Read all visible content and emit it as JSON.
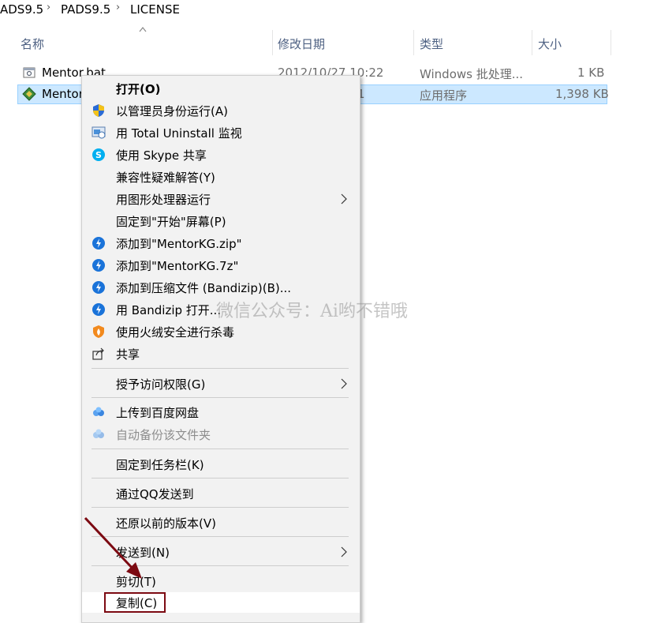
{
  "breadcrumb": {
    "items": [
      "ADS9.5",
      "PADS9.5",
      "LICENSE"
    ]
  },
  "columns": {
    "name": "名称",
    "date": "修改日期",
    "type": "类型",
    "size": "大小"
  },
  "files": [
    {
      "name": "Mentor.bat",
      "date": "2012/10/27 10:22",
      "type": "Windows 批处理...",
      "size": "1 KB",
      "icon": "batch-file-icon",
      "selected": false
    },
    {
      "name": "Mentor",
      "date": "1",
      "type": "应用程序",
      "size": "1,398 KB",
      "icon": "application-icon",
      "selected": true
    }
  ],
  "context_menu": {
    "items": [
      {
        "label": "打开(O)",
        "icon": "",
        "bold": true
      },
      {
        "label": "以管理员身份运行(A)",
        "icon": "uac-shield-icon"
      },
      {
        "label": "用 Total Uninstall 监视",
        "icon": "total-uninstall-icon"
      },
      {
        "label": "使用 Skype 共享",
        "icon": "skype-icon"
      },
      {
        "label": "兼容性疑难解答(Y)",
        "icon": ""
      },
      {
        "label": "用图形处理器运行",
        "icon": "",
        "submenu": true
      },
      {
        "label": "固定到\"开始\"屏幕(P)",
        "icon": ""
      },
      {
        "label": "添加到\"MentorKG.zip\"",
        "icon": "bandizip-icon"
      },
      {
        "label": "添加到\"MentorKG.7z\"",
        "icon": "bandizip-icon"
      },
      {
        "label": "添加到压缩文件 (Bandizip)(B)...",
        "icon": "bandizip-icon"
      },
      {
        "label": "用 Bandizip 打开...",
        "icon": "bandizip-icon"
      },
      {
        "label": "使用火绒安全进行杀毒",
        "icon": "huorong-icon"
      },
      {
        "label": "共享",
        "icon": "share-icon"
      },
      {
        "label": "授予访问权限(G)",
        "icon": "",
        "submenu": true
      },
      {
        "label": "上传到百度网盘",
        "icon": "baidu-netdisk-icon"
      },
      {
        "label": "自动备份该文件夹",
        "icon": "baidu-netdisk-icon",
        "disabled": true
      },
      {
        "label": "固定到任务栏(K)",
        "icon": ""
      },
      {
        "label": "通过QQ发送到",
        "icon": ""
      },
      {
        "label": "还原以前的版本(V)",
        "icon": ""
      },
      {
        "label": "发送到(N)",
        "icon": "",
        "submenu": true
      },
      {
        "label": "剪切(T)",
        "icon": ""
      },
      {
        "label": "复制(C)",
        "icon": "",
        "highlighted": true
      }
    ]
  },
  "watermark": "微信公众号：Ai哟不错哦",
  "colors": {
    "selection_bg": "#cce8ff",
    "menu_bg": "#f2f2f2",
    "annotation": "#7c0a12",
    "header_text": "#4d6082"
  }
}
